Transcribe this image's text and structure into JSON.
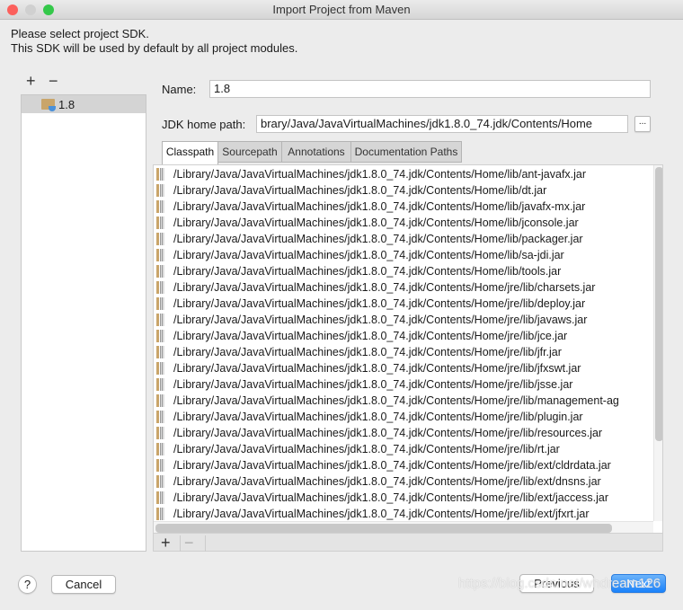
{
  "window": {
    "title": "Import Project from Maven"
  },
  "description": {
    "line1": "Please select project SDK.",
    "line2": "This SDK will be used by default by all project modules."
  },
  "sdk_toolbar": {
    "add": "+",
    "remove": "−"
  },
  "sdk_list": [
    {
      "label": "1.8",
      "icon": "jdk-folder-icon",
      "selected": true
    }
  ],
  "form": {
    "name_label": "Name:",
    "name_value": "1.8",
    "jdk_label": "JDK home path:",
    "jdk_value": "brary/Java/JavaVirtualMachines/jdk1.8.0_74.jdk/Contents/Home",
    "browse": "..."
  },
  "tabs": [
    {
      "label": "Classpath",
      "active": true
    },
    {
      "label": "Sourcepath"
    },
    {
      "label": "Annotations"
    },
    {
      "label": "Documentation Paths"
    }
  ],
  "classpath": [
    "/Library/Java/JavaVirtualMachines/jdk1.8.0_74.jdk/Contents/Home/lib/ant-javafx.jar",
    "/Library/Java/JavaVirtualMachines/jdk1.8.0_74.jdk/Contents/Home/lib/dt.jar",
    "/Library/Java/JavaVirtualMachines/jdk1.8.0_74.jdk/Contents/Home/lib/javafx-mx.jar",
    "/Library/Java/JavaVirtualMachines/jdk1.8.0_74.jdk/Contents/Home/lib/jconsole.jar",
    "/Library/Java/JavaVirtualMachines/jdk1.8.0_74.jdk/Contents/Home/lib/packager.jar",
    "/Library/Java/JavaVirtualMachines/jdk1.8.0_74.jdk/Contents/Home/lib/sa-jdi.jar",
    "/Library/Java/JavaVirtualMachines/jdk1.8.0_74.jdk/Contents/Home/lib/tools.jar",
    "/Library/Java/JavaVirtualMachines/jdk1.8.0_74.jdk/Contents/Home/jre/lib/charsets.jar",
    "/Library/Java/JavaVirtualMachines/jdk1.8.0_74.jdk/Contents/Home/jre/lib/deploy.jar",
    "/Library/Java/JavaVirtualMachines/jdk1.8.0_74.jdk/Contents/Home/jre/lib/javaws.jar",
    "/Library/Java/JavaVirtualMachines/jdk1.8.0_74.jdk/Contents/Home/jre/lib/jce.jar",
    "/Library/Java/JavaVirtualMachines/jdk1.8.0_74.jdk/Contents/Home/jre/lib/jfr.jar",
    "/Library/Java/JavaVirtualMachines/jdk1.8.0_74.jdk/Contents/Home/jre/lib/jfxswt.jar",
    "/Library/Java/JavaVirtualMachines/jdk1.8.0_74.jdk/Contents/Home/jre/lib/jsse.jar",
    "/Library/Java/JavaVirtualMachines/jdk1.8.0_74.jdk/Contents/Home/jre/lib/management-ag",
    "/Library/Java/JavaVirtualMachines/jdk1.8.0_74.jdk/Contents/Home/jre/lib/plugin.jar",
    "/Library/Java/JavaVirtualMachines/jdk1.8.0_74.jdk/Contents/Home/jre/lib/resources.jar",
    "/Library/Java/JavaVirtualMachines/jdk1.8.0_74.jdk/Contents/Home/jre/lib/rt.jar",
    "/Library/Java/JavaVirtualMachines/jdk1.8.0_74.jdk/Contents/Home/jre/lib/ext/cldrdata.jar",
    "/Library/Java/JavaVirtualMachines/jdk1.8.0_74.jdk/Contents/Home/jre/lib/ext/dnsns.jar",
    "/Library/Java/JavaVirtualMachines/jdk1.8.0_74.jdk/Contents/Home/jre/lib/ext/jaccess.jar",
    "/Library/Java/JavaVirtualMachines/jdk1.8.0_74.jdk/Contents/Home/jre/lib/ext/jfxrt.jar"
  ],
  "list_toolbar": {
    "add": "+",
    "remove": "−"
  },
  "buttons": {
    "help": "?",
    "cancel": "Cancel",
    "previous": "Previous",
    "next": "Next"
  },
  "watermark": "https://blog.csdn.net/whdream126",
  "colors": {
    "accent": "#1a82fb",
    "selection": "#d4d4d4"
  }
}
